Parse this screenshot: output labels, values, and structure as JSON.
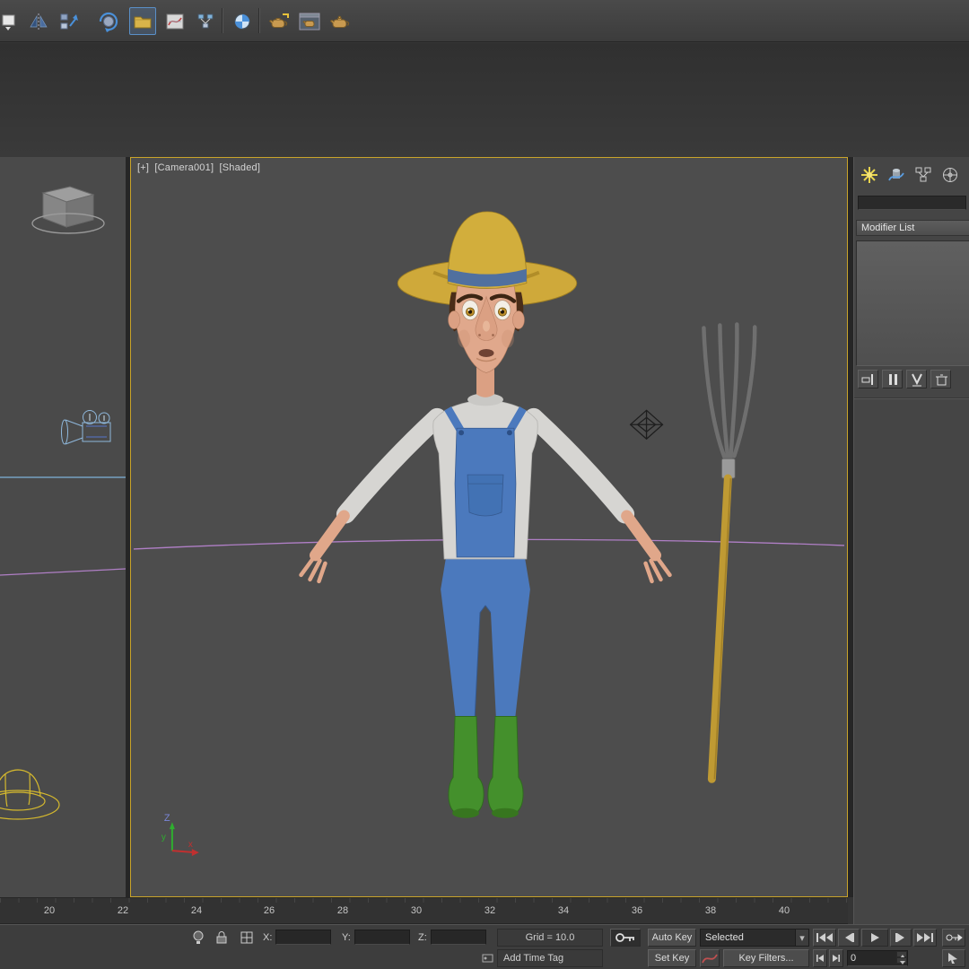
{
  "colors": {
    "active_viewport_border": "#c9a42a",
    "viewport_bg": "#4d4d4d",
    "panel_bg": "#454545",
    "overalls_blue": "#4b79bd",
    "hat_yellow": "#d2ae3c",
    "boots_green": "#44902c",
    "horizon_purple": "#b07fc6"
  },
  "toolbar": {
    "icon_names": [
      "workspace-dropdown",
      "mirror",
      "align",
      "layer-rotate",
      "scene-explorer",
      "curve-editor",
      "schematic-view",
      "material-editor",
      "render-setup",
      "rendered-frame-window",
      "render-production"
    ]
  },
  "viewport": {
    "label_plus": "[+]",
    "label_camera": "[Camera001]",
    "label_shading": "[Shaded]",
    "axis_x": "x",
    "axis_y": "y",
    "axis_z": "Z"
  },
  "command_panel": {
    "tabs": [
      "create",
      "modify",
      "hierarchy",
      "motion"
    ],
    "object_name": "",
    "modifier_list": "Modifier List",
    "stack_buttons": [
      "pin-stack",
      "show-end-result",
      "make-unique",
      "remove-modifier"
    ]
  },
  "timeline": {
    "ticks": [
      "20",
      "22",
      "24",
      "26",
      "28",
      "30",
      "32",
      "34",
      "36",
      "38",
      "40"
    ]
  },
  "status_bar": {
    "x_label": "X:",
    "y_label": "Y:",
    "z_label": "Z:",
    "coord_x": "",
    "coord_y": "",
    "coord_z": "",
    "grid": "Grid = 10.0",
    "add_time_tag": "Add Time Tag",
    "auto_key": "Auto Key",
    "set_key": "Set Key",
    "selected_mode": "Selected",
    "key_filters": "Key Filters...",
    "frame_value": "0",
    "playback_buttons": [
      "go-to-start",
      "previous-frame",
      "play",
      "next-frame",
      "go-to-end"
    ],
    "key_step_buttons": [
      "previous-key",
      "next-key"
    ],
    "status_icons": [
      "isolate-selection",
      "selection-lock",
      "transform-typein",
      "set-keys-key",
      "default-tangent-curve",
      "time-tag"
    ]
  }
}
